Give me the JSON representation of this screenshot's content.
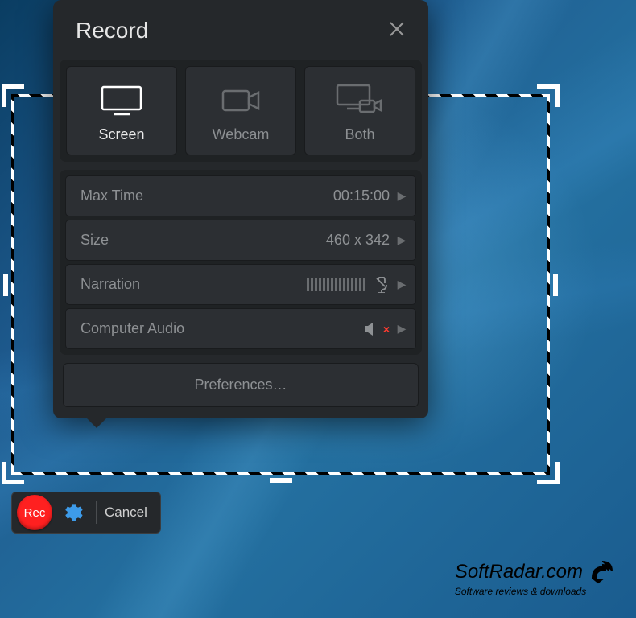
{
  "panel": {
    "title": "Record",
    "sources": {
      "screen": "Screen",
      "webcam": "Webcam",
      "both": "Both"
    },
    "settings": {
      "max_time": {
        "label": "Max Time",
        "value": "00:15:00"
      },
      "size": {
        "label": "Size",
        "value": "460 x 342"
      },
      "narration": {
        "label": "Narration"
      },
      "computer_audio": {
        "label": "Computer Audio",
        "muted": true
      }
    },
    "preferences": "Preferences…"
  },
  "toolbar": {
    "rec": "Rec",
    "cancel": "Cancel"
  },
  "watermark": {
    "title": "SoftRadar.com",
    "subtitle": "Software reviews & downloads"
  }
}
